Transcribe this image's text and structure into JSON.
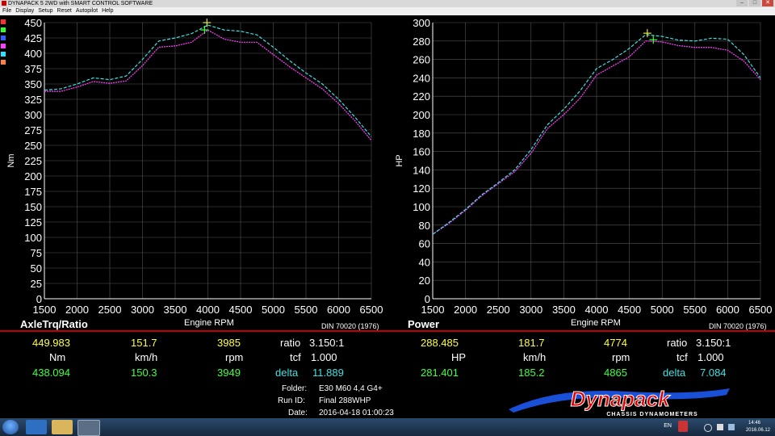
{
  "window": {
    "title": "DYNAPACK 5 2WD with SMART CONTROL SOFTWARE"
  },
  "menu": [
    "File",
    "Display",
    "Setup",
    "Reset",
    "Autopilot",
    "Help"
  ],
  "series_colors": {
    "run1": "#ff40ff",
    "run2": "#40e0e0",
    "swatches": [
      "#ff3030",
      "#30ff30",
      "#3060ff",
      "#ff40ff",
      "#30e0ff",
      "#ff8040"
    ]
  },
  "torque_panel": {
    "title": "AxleTrq/Ratio",
    "x_caption": "Engine RPM",
    "standard": "DIN 70020 (1976)",
    "readout1": {
      "value": "449.983",
      "speed": "151.7",
      "rpm": "3985",
      "ratio_label": "ratio",
      "ratio": "3.150:1"
    },
    "units": {
      "value_unit": "Nm",
      "speed_unit": "km/h",
      "rpm_unit": "rpm",
      "tcf_label": "tcf",
      "tcf": "1.000"
    },
    "readout2": {
      "value": "438.094",
      "speed": "150.3",
      "rpm": "3949",
      "delta_label": "delta",
      "delta": "11.889"
    }
  },
  "power_panel": {
    "title": "Power",
    "x_caption": "Engine RPM",
    "standard": "DIN 70020 (1976)",
    "readout1": {
      "value": "288.485",
      "speed": "181.7",
      "rpm": "4774",
      "ratio_label": "ratio",
      "ratio": "3.150:1"
    },
    "units": {
      "value_unit": "HP",
      "speed_unit": "km/h",
      "rpm_unit": "rpm",
      "tcf_label": "tcf",
      "tcf": "1.000"
    },
    "readout2": {
      "value": "281.401",
      "speed": "185.2",
      "rpm": "4865",
      "delta_label": "delta",
      "delta": "7.084"
    }
  },
  "run_info": {
    "folder_label": "Folder:",
    "folder": "E30 M60 4,4 G4+",
    "runid_label": "Run ID:",
    "runid": "Final 288WHP",
    "date_label": "Date:",
    "date": "2016-04-18 01:00:23"
  },
  "logo": {
    "name": "Dynapack",
    "tagline": "CHASSIS DYNAMOMETERS"
  },
  "taskbar": {
    "lang": "EN",
    "time": "14:46",
    "date": "2016.06.12"
  },
  "chart_data": [
    {
      "type": "line",
      "title": "AxleTrq/Ratio",
      "xlabel": "Engine RPM",
      "ylabel": "Nm",
      "xlim": [
        1500,
        6500
      ],
      "ylim": [
        0,
        450
      ],
      "xticks": [
        1500,
        2000,
        2500,
        3000,
        3500,
        4000,
        4500,
        5000,
        5500,
        6000,
        6500
      ],
      "yticks": [
        0,
        25,
        50,
        75,
        100,
        125,
        150,
        175,
        200,
        225,
        250,
        275,
        300,
        325,
        350,
        375,
        400,
        425,
        450
      ],
      "grid": true,
      "x": [
        1500,
        1750,
        2000,
        2250,
        2500,
        2750,
        3000,
        3250,
        3500,
        3750,
        4000,
        4250,
        4500,
        4750,
        5000,
        5250,
        5500,
        5750,
        6000,
        6250,
        6500
      ],
      "series": [
        {
          "values": [
            338,
            338,
            345,
            354,
            351,
            355,
            380,
            410,
            412,
            418,
            438,
            423,
            418,
            418,
            398,
            378,
            360,
            342,
            318,
            290,
            258
          ]
        },
        {
          "values": [
            340,
            342,
            350,
            360,
            357,
            363,
            390,
            420,
            425,
            432,
            446,
            438,
            436,
            430,
            410,
            388,
            368,
            350,
            325,
            296,
            264
          ]
        }
      ],
      "markers": [
        {
          "x": 3985,
          "y": 449.983,
          "series": 1
        },
        {
          "x": 3949,
          "y": 438.094,
          "series": 0
        }
      ]
    },
    {
      "type": "line",
      "title": "Power",
      "xlabel": "Engine RPM",
      "ylabel": "HP",
      "xlim": [
        1500,
        6500
      ],
      "ylim": [
        0,
        300
      ],
      "xticks": [
        1500,
        2000,
        2500,
        3000,
        3500,
        4000,
        4500,
        5000,
        5500,
        6000,
        6500
      ],
      "yticks": [
        0,
        20,
        40,
        60,
        80,
        100,
        120,
        140,
        160,
        180,
        200,
        220,
        240,
        260,
        280,
        300
      ],
      "grid": true,
      "x": [
        1500,
        1750,
        2000,
        2250,
        2500,
        2750,
        3000,
        3250,
        3500,
        3750,
        4000,
        4250,
        4500,
        4750,
        5000,
        5250,
        5500,
        5750,
        6000,
        6250,
        6500
      ],
      "series": [
        {
          "values": [
            70,
            82,
            96,
            112,
            125,
            138,
            158,
            185,
            200,
            218,
            243,
            253,
            263,
            280,
            279,
            275,
            273,
            273,
            270,
            258,
            238
          ]
        },
        {
          "values": [
            70,
            83,
            97,
            113,
            126,
            140,
            162,
            189,
            206,
            226,
            250,
            260,
            272,
            287,
            285,
            281,
            280,
            283,
            282,
            265,
            240
          ]
        }
      ],
      "markers": [
        {
          "x": 4774,
          "y": 288.485,
          "series": 1
        },
        {
          "x": 4865,
          "y": 281.401,
          "series": 0
        }
      ]
    }
  ]
}
